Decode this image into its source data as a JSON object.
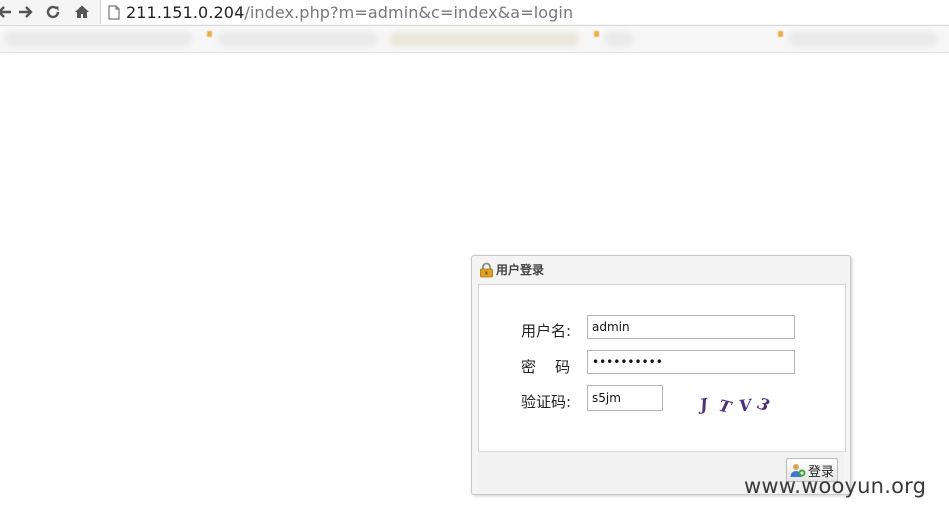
{
  "browser": {
    "url_host": "211.151.0.204",
    "url_path": "/index.php?m=admin&c=index&a=login",
    "icons": [
      "back-arrow-icon",
      "forward-arrow-icon",
      "reload-icon",
      "home-icon",
      "page-icon"
    ]
  },
  "login": {
    "title": "用户登录",
    "username_label": "用户名:",
    "username_value": "admin",
    "password_label": "密    码",
    "password_value": "••••••••••",
    "captcha_label": "验证码:",
    "captcha_value": "s5jm",
    "captcha_chars": [
      "J",
      "T",
      "V",
      "3"
    ],
    "submit_label": "登录"
  },
  "watermark": "www.wooyun.org",
  "colors": {
    "captcha_text": "#4a2f7a",
    "lock_icon": "#e0a020"
  }
}
